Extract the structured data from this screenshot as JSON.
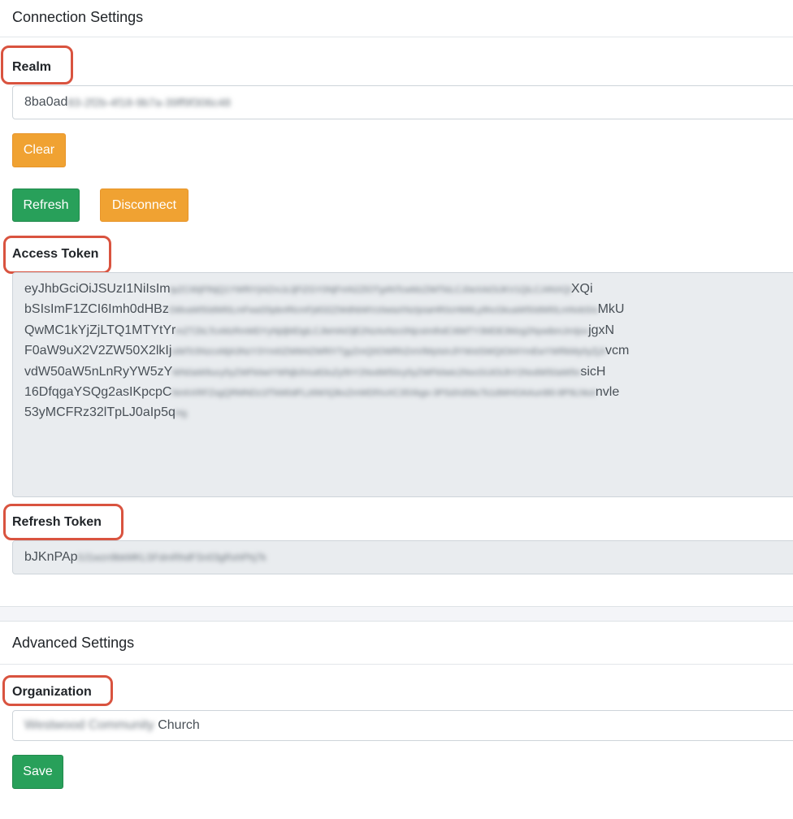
{
  "connection": {
    "header": "Connection Settings",
    "realm_label": "Realm",
    "realm_visible": "8ba0ad",
    "realm_hidden": "83-2f2b-4f18-9b7a-39ff9f306c48",
    "clear_label": "Clear",
    "refresh_label": "Refresh",
    "disconnect_label": "Disconnect",
    "access_token_label": "Access Token",
    "access_token_lines": [
      {
        "visible": "eyJhbGciOiJSUzI1NiIsIm",
        "hidden": "tpZCI6IjFlNjQ1YWRiYjI4ZmJzJjFiZGY0NjFmN2ZlOTg4NTcwMzZiMTkiLCJ0eXAiOiJKV1QiLCJ4NXQi",
        "tail": "XQi"
      },
      {
        "visible": "bSIsImF1ZCI6Imh0dHBz",
        "hidden": "Oi8vaW50dWl0LmFwaS5pbnRlcmFjdGl2ZWdhbWVzIiwiaXNzIjoiaHR0cHM6Ly9hcGkuaW50dWl0LmNvbSIs",
        "tail": "MkU"
      },
      {
        "visible": "QwMC1kYjZjLTQ1MTYtYr",
        "hidden": "mZTZkLTcxMzRmMDYyNjdjMDgiLCJleHAiOjE2NzAxNzc0NjcsImlhdCI6MTY3MDE3Mzg2NywibmJmIjox",
        "tail": "jgxN"
      },
      {
        "visible": "F0aW9uX2V2ZW50X2lkIj",
        "hidden": "oiMTc5NzcxMjA3NzY3YmI0ZWM4ZWRlYTgyZmQ0OWRhZmVlMyIsInJlYWxtSWQiOiI4YmEwYWRkMy0yZjJi",
        "tail": "vcm"
      },
      {
        "visible": "vdW50aW5nLnRyYW5zY",
        "hidden": "WN0aW9ucy5yZWFkIiwiYWNjb3VudGluZy5hY2NvdW50cy5yZWFkIiwic2NvcGUiOiJhY2NvdW50aW5n",
        "tail": "sicH"
      },
      {
        "visible": "16DfqgaYSQg2asIKpcpC",
        "hidden": "NmhXRFZsgQRMNDz1fTkM0dFLz6WXj3kxZmWDfXxXC35Xkgo-3PSdXdSkcTs1dWHOAAun9l0-8P9Lhkol",
        "tail": "nvle"
      },
      {
        "visible": "53yMCFRz32lTpLJ0aIp5q",
        "hidden": "Hg",
        "tail": ""
      }
    ],
    "refresh_token_label": "Refresh Token",
    "refresh_token_visible": "bJKnPAp",
    "refresh_token_hidden": "0J1wzn9bkMKLSFdmRhdFSn03gRxhPhj7k"
  },
  "advanced": {
    "header": "Advanced Settings",
    "organization_label": "Organization",
    "organization_hidden": "Westwood Community",
    "organization_visible": " Church",
    "save_label": "Save"
  }
}
